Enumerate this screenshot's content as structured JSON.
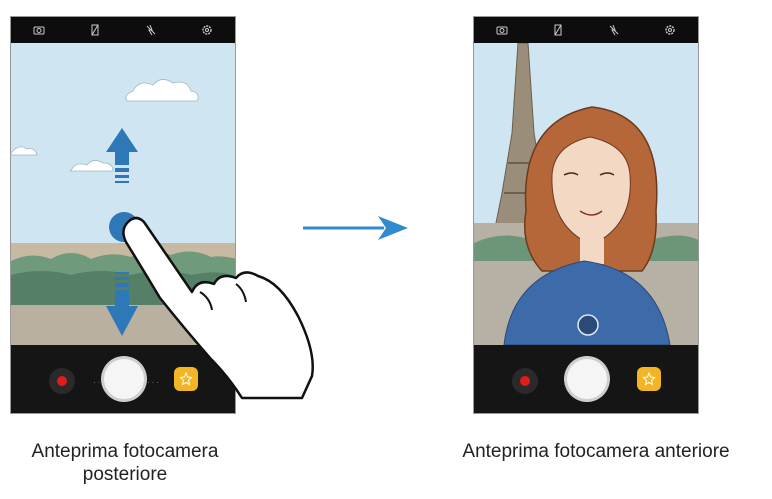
{
  "captions": {
    "rear_line1": "Anteprima fotocamera",
    "rear_line2": "posteriore",
    "front": "Anteprima fotocamera anteriore"
  },
  "icons": [
    "camera-switch-icon",
    "flash-off-icon",
    "beauty-off-icon",
    "settings-icon",
    "record-icon",
    "shutter-icon",
    "effects-icon",
    "swipe-up-arrow-icon",
    "swipe-down-arrow-icon",
    "finger-icon",
    "transition-arrow-icon",
    "camera-switch-overlay-icon"
  ],
  "colors": {
    "accent_arrow": "#2f8ad0",
    "record": "#e21b1b",
    "effects": "#f3b526"
  }
}
